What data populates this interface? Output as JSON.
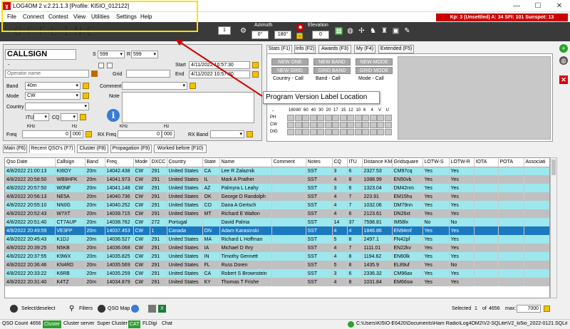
{
  "window": {
    "title": "LOG4OM 2 v.2.21.1.3 [Profile: KI5IO_012122]",
    "minimize": "—",
    "maximize": "☐",
    "close": "✕"
  },
  "kp_bar": "Kp: 3 (Unsettled) A: 34 SFI: 101 Sunspot: 13",
  "menu": [
    "File",
    "Connect",
    "Contest",
    "View",
    "Utilities",
    "Settings",
    "Help"
  ],
  "toolbar": {
    "offline": "OFFLINE",
    "spin_value": "1",
    "azimuth_label": "Azimuth",
    "az1": "0°",
    "az2": "180°",
    "elevation_label": "Elevation",
    "elev_value": "0"
  },
  "qso_form": {
    "callsign": "CALLSIGN",
    "s_label": "S",
    "s_value": "599",
    "r_label": "R",
    "r_value": "599",
    "dash": "-",
    "operator_placeholder": "Operator name",
    "grid_label": "Grid",
    "start_label": "Start",
    "start_value": "4/11/2022 10:57:30",
    "end_label": "End",
    "end_value": "4/11/2022 10:57:30",
    "band_label": "Band",
    "band_value": "40m",
    "mode_label": "Mode",
    "mode_value": "CW",
    "country_label": "Country",
    "comment_label": "Comment",
    "note_label": "Note",
    "itu_label": "ITU",
    "cq_label": "CQ",
    "khz": "KHz",
    "hz": "Hz",
    "freq_label": "Freq",
    "freq_value": "0",
    "freq_hz": "000",
    "rx_freq_label": "RX Freq",
    "rx_freq_value": "0",
    "rx_freq_hz": "000",
    "rx_band_label": "RX Band"
  },
  "stats_tabs": [
    "Stats (F1)",
    "Info (F2)",
    "Awards (F3)",
    "My (F4)",
    "Extended (F5)"
  ],
  "stats": {
    "btn_new_one": "NEW ONE",
    "btn_new_band": "NEW BAND",
    "btn_new_mode": "NEW MODE",
    "btn_new_grid": "NEW GRID",
    "btn_grid_band": "GRID BAND",
    "btn_grid_mode": "GRID MODE",
    "lbl1": "Country - Call",
    "lbl2": "Band - Call",
    "lbl3": "Mode - Call",
    "bands": [
      "160",
      "80",
      "60",
      "40",
      "30",
      "20",
      "17",
      "15",
      "12",
      "10",
      "6",
      "4",
      "V",
      "U"
    ],
    "rows": [
      "PH",
      "CW",
      "DIG"
    ],
    "dash": "-"
  },
  "callout": "Program Version Label Location",
  "main_tabs": [
    "Main (F6)",
    "Recent QSO's (F7)",
    "Cluster (F8)",
    "Propagation (F9)",
    "Worked before (F10)"
  ],
  "table": {
    "headers": [
      "Qso Date",
      "Callsign",
      "Band",
      "Freq",
      "Mode",
      "DXCC",
      "Country",
      "State",
      "Name",
      "Comment",
      "Notes",
      "CQ",
      "ITU",
      "Distance KM",
      "Gridsquare",
      "LOTW-S",
      "LOTW-R",
      "IOTA",
      "POTA",
      "Associati"
    ],
    "rows": [
      [
        "4/8/2022 21:00:13",
        "KI6OY",
        "20m",
        "14042.438",
        "CW",
        "291",
        "United States",
        "CA",
        "Lee R Zalaznik",
        "",
        "SST",
        "3",
        "6",
        "2327.53",
        "CM97cq",
        "Yes",
        "Yes",
        "",
        ""
      ],
      [
        "4/8/2022 20:58:50",
        "WB9HFK",
        "20m",
        "14041.973",
        "CW",
        "291",
        "United States",
        "IL",
        "Mark A Prather",
        "",
        "SST",
        "4",
        "8",
        "1088.99",
        "EN50vb",
        "Yes",
        "Yes",
        "",
        ""
      ],
      [
        "4/8/2022 20:57:50",
        "W0NF",
        "20m",
        "14041.148",
        "CW",
        "291",
        "United States",
        "AZ",
        "Palmyra L Leahy",
        "",
        "SST",
        "3",
        "6",
        "1323.04",
        "DM42nm",
        "Yes",
        "Yes",
        "",
        ""
      ],
      [
        "4/8/2022 20:56:13",
        "NE5A",
        "20m",
        "14040.736",
        "CW",
        "291",
        "United States",
        "OK",
        "George D Randolph",
        "",
        "SST",
        "4",
        "7",
        "223.91",
        "EM15hu",
        "Yes",
        "Yes",
        "",
        ""
      ],
      [
        "4/8/2022 20:55:10",
        "NN0G",
        "20m",
        "14040.252",
        "CW",
        "291",
        "United States",
        "CO",
        "Dana A Gertsch",
        "",
        "SST",
        "4",
        "7",
        "1032.06",
        "DM79nn",
        "Yes",
        "Yes",
        "",
        ""
      ],
      [
        "4/8/2022 20:52:43",
        "W7XT",
        "20m",
        "14039.715",
        "CW",
        "291",
        "United States",
        "MT",
        "Richard E Walton",
        "",
        "SST",
        "4",
        "6",
        "2123.61",
        "DN26xt",
        "Yes",
        "Yes",
        "",
        ""
      ],
      [
        "4/8/2022 20:51:40",
        "CT7AUP",
        "20m",
        "14038.762",
        "CW",
        "272",
        "Portugal",
        "",
        "David Palma",
        "",
        "SST",
        "14",
        "37",
        "7598.81",
        "IM58lx",
        "No",
        "No",
        "",
        ""
      ],
      [
        "4/8/2022 20:49:59",
        "VE3FP",
        "20m",
        "14037.453",
        "CW",
        "1",
        "Canada",
        "ON",
        "Adam Karasinski",
        "",
        "SST",
        "4",
        "4",
        "1846.86",
        "EN94mf",
        "Yes",
        "Yes",
        "",
        ""
      ],
      [
        "4/8/2022 20:45:43",
        "K1DJ",
        "20m",
        "14036.527",
        "CW",
        "291",
        "United States",
        "MA",
        "Richard L Hoffman",
        "",
        "SST",
        "5",
        "8",
        "2497.1",
        "FN42pf",
        "Yes",
        "Yes",
        "",
        ""
      ],
      [
        "4/8/2022 20:39:25",
        "N5KB",
        "20m",
        "14036.068",
        "CW",
        "291",
        "United States",
        "IA",
        "Michael D Ihry",
        "",
        "SST",
        "4",
        "7",
        "1111.01",
        "EN22kv",
        "Yes",
        "Yes",
        "",
        ""
      ],
      [
        "4/8/2022 20:37:55",
        "K9WX",
        "20m",
        "14035.825",
        "CW",
        "291",
        "United States",
        "IN",
        "Timothy Gennett",
        "",
        "SST",
        "4",
        "8",
        "1194.62",
        "EN60lk",
        "Yes",
        "Yes",
        "",
        ""
      ],
      [
        "4/8/2022 20:36:46",
        "KN4RD",
        "20m",
        "14035.569",
        "CW",
        "291",
        "United States",
        "FL",
        "Russ Doren",
        "",
        "SST",
        "5",
        "8",
        "1435.9",
        "EL89uf",
        "Yes",
        "No",
        "",
        ""
      ],
      [
        "4/8/2022 20:33:22",
        "K6RB",
        "20m",
        "14035.259",
        "CW",
        "291",
        "United States",
        "CA",
        "Robert S Brownstein",
        "",
        "SST",
        "3",
        "6",
        "2336.32",
        "CM96ax",
        "Yes",
        "Yes",
        "",
        ""
      ],
      [
        "4/8/2022 20:31:40",
        "K4TZ",
        "20m",
        "14034.879",
        "CW",
        "291",
        "United States",
        "KY",
        "Thomas T Frishe",
        "",
        "SST",
        "4",
        "8",
        "1031.84",
        "EM66sw",
        "Yes",
        "Yes",
        "",
        ""
      ]
    ],
    "selected_index": 7
  },
  "bottom": {
    "select_deselect": "Select/deselect",
    "filters": "Filters",
    "qso_map": "QSO Map",
    "selected_label": "Selected",
    "selected_value": "1",
    "of": "of",
    "total": "4656",
    "max_label": "max:",
    "max_value": "7000"
  },
  "status": {
    "qso_count_label": "QSO Count",
    "qso_count": "4656",
    "cluster": "Cluster",
    "cluster_server": "Cluster server",
    "super_cluster": "Super Cluster",
    "cat": "CAT",
    "fldigi": "FLDigi",
    "chat": "Chat",
    "path": "C:\\Users\\KI5IO-E6420\\Documents\\Ham Radio\\Log4OM2\\V2-SQLite\\V2_ki5io_2022-0121.SQLite"
  }
}
